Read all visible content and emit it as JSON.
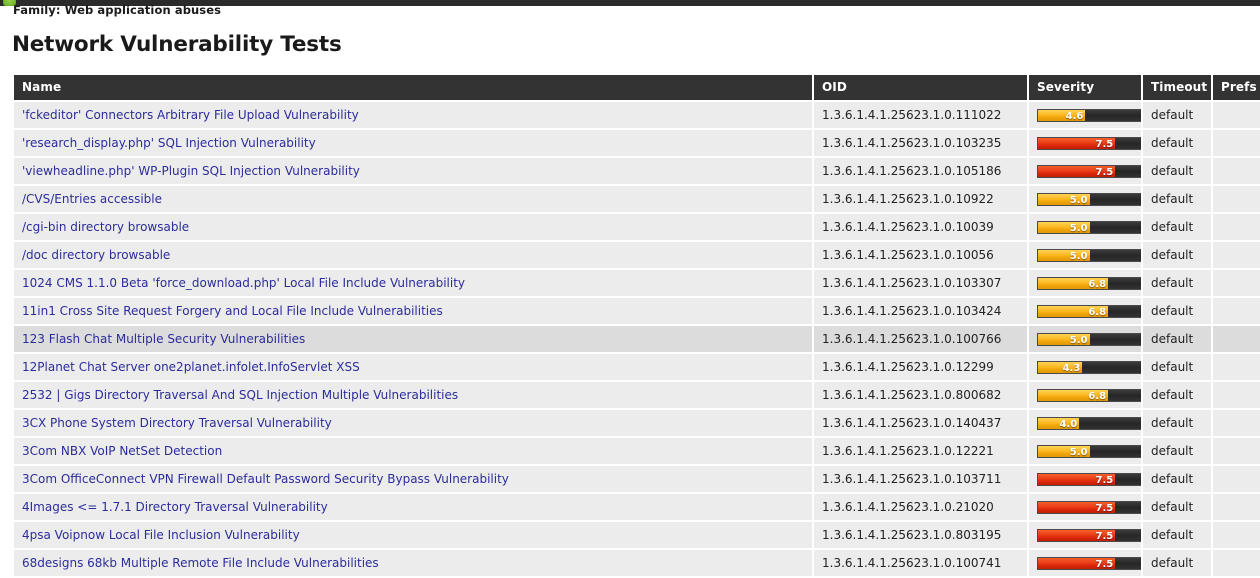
{
  "topbar": {
    "icon": "green-app-icon"
  },
  "breadcrumb": {
    "family_label": "Family: Web application abuses"
  },
  "page": {
    "title": "Network Vulnerability Tests"
  },
  "table": {
    "columns": [
      "Name",
      "OID",
      "Severity",
      "Timeout",
      "Prefs"
    ],
    "rows": [
      {
        "name": "'fckeditor' Connectors Arbitrary File Upload Vulnerability",
        "oid": "1.3.6.1.4.1.25623.1.0.111022",
        "severity": "4.6",
        "timeout": "default",
        "prefs": "",
        "hovered": false
      },
      {
        "name": "'research_display.php' SQL Injection Vulnerability",
        "oid": "1.3.6.1.4.1.25623.1.0.103235",
        "severity": "7.5",
        "timeout": "default",
        "prefs": "",
        "hovered": false
      },
      {
        "name": "'viewheadline.php' WP-Plugin SQL Injection Vulnerability",
        "oid": "1.3.6.1.4.1.25623.1.0.105186",
        "severity": "7.5",
        "timeout": "default",
        "prefs": "",
        "hovered": false
      },
      {
        "name": "/CVS/Entries accessible",
        "oid": "1.3.6.1.4.1.25623.1.0.10922",
        "severity": "5.0",
        "timeout": "default",
        "prefs": "",
        "hovered": false
      },
      {
        "name": "/cgi-bin directory browsable",
        "oid": "1.3.6.1.4.1.25623.1.0.10039",
        "severity": "5.0",
        "timeout": "default",
        "prefs": "",
        "hovered": false
      },
      {
        "name": "/doc directory browsable",
        "oid": "1.3.6.1.4.1.25623.1.0.10056",
        "severity": "5.0",
        "timeout": "default",
        "prefs": "",
        "hovered": false
      },
      {
        "name": "1024 CMS 1.1.0 Beta 'force_download.php' Local File Include Vulnerability",
        "oid": "1.3.6.1.4.1.25623.1.0.103307",
        "severity": "6.8",
        "timeout": "default",
        "prefs": "",
        "hovered": false
      },
      {
        "name": "11in1 Cross Site Request Forgery and Local File Include Vulnerabilities",
        "oid": "1.3.6.1.4.1.25623.1.0.103424",
        "severity": "6.8",
        "timeout": "default",
        "prefs": "",
        "hovered": false
      },
      {
        "name": "123 Flash Chat Multiple Security Vulnerabilities",
        "oid": "1.3.6.1.4.1.25623.1.0.100766",
        "severity": "5.0",
        "timeout": "default",
        "prefs": "",
        "hovered": true
      },
      {
        "name": "12Planet Chat Server one2planet.infolet.InfoServlet XSS",
        "oid": "1.3.6.1.4.1.25623.1.0.12299",
        "severity": "4.3",
        "timeout": "default",
        "prefs": "",
        "hovered": false
      },
      {
        "name": "2532 | Gigs Directory Traversal And SQL Injection Multiple Vulnerabilities",
        "oid": "1.3.6.1.4.1.25623.1.0.800682",
        "severity": "6.8",
        "timeout": "default",
        "prefs": "",
        "hovered": false
      },
      {
        "name": "3CX Phone System Directory Traversal Vulnerability",
        "oid": "1.3.6.1.4.1.25623.1.0.140437",
        "severity": "4.0",
        "timeout": "default",
        "prefs": "",
        "hovered": false
      },
      {
        "name": "3Com NBX VoIP NetSet Detection",
        "oid": "1.3.6.1.4.1.25623.1.0.12221",
        "severity": "5.0",
        "timeout": "default",
        "prefs": "",
        "hovered": false
      },
      {
        "name": "3Com OfficeConnect VPN Firewall Default Password Security Bypass Vulnerability",
        "oid": "1.3.6.1.4.1.25623.1.0.103711",
        "severity": "7.5",
        "timeout": "default",
        "prefs": "",
        "hovered": false
      },
      {
        "name": "4Images <= 1.7.1 Directory Traversal Vulnerability",
        "oid": "1.3.6.1.4.1.25623.1.0.21020",
        "severity": "7.5",
        "timeout": "default",
        "prefs": "",
        "hovered": false
      },
      {
        "name": "4psa Voipnow Local File Inclusion Vulnerability",
        "oid": "1.3.6.1.4.1.25623.1.0.803195",
        "severity": "7.5",
        "timeout": "default",
        "prefs": "",
        "hovered": false
      },
      {
        "name": "68designs 68kb Multiple Remote File Include Vulnerabilities",
        "oid": "1.3.6.1.4.1.25623.1.0.100741",
        "severity": "7.5",
        "timeout": "default",
        "prefs": "",
        "hovered": false
      }
    ]
  },
  "colors": {
    "header_bg": "#333333",
    "row_bg": "#ececec",
    "row_hover_bg": "#dcdcdc",
    "link": "#2c2c9c",
    "severity_low": "#f0a30a",
    "severity_high": "#d42206",
    "bar_track": "#2f2f2f"
  },
  "severity_scale_max": 10
}
